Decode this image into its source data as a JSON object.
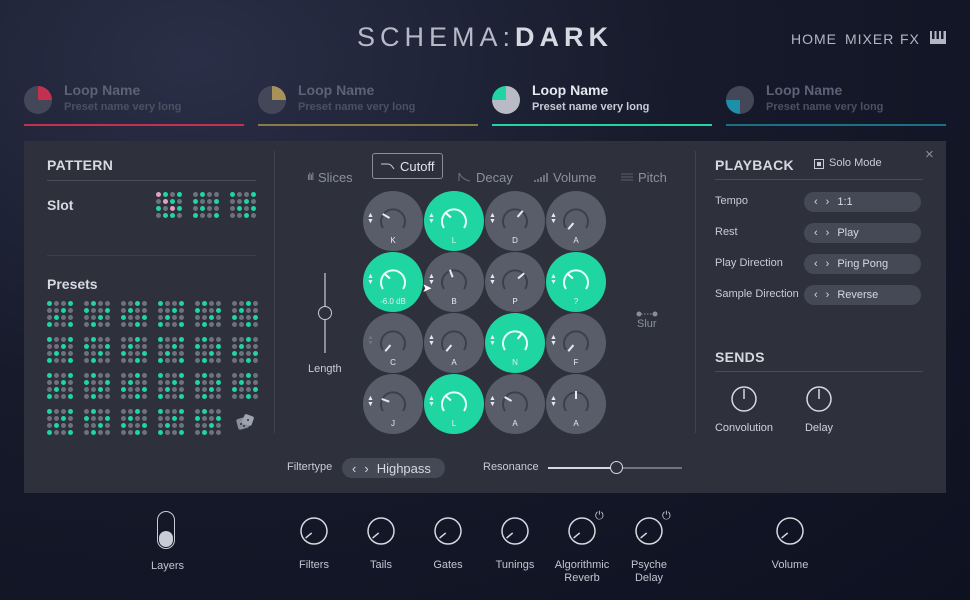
{
  "header": {
    "logo_light": "SCHEMA:",
    "logo_bold": "DARK",
    "nav": [
      "HOME",
      "MIXER",
      "FX"
    ],
    "keys_icon": "piano-keys-icon"
  },
  "layers": [
    {
      "name": "Loop Name",
      "preset": "Preset name very long",
      "color": "#c2324f"
    },
    {
      "name": "Loop Name",
      "preset": "Preset name very long",
      "color": "#a9925a"
    },
    {
      "name": "Loop Name",
      "preset": "Preset name very long",
      "color": "#1fd6a2"
    },
    {
      "name": "Loop Name",
      "preset": "Preset name very long",
      "color": "#1e8fa8"
    }
  ],
  "pattern": {
    "title": "PATTERN",
    "slot_label": "Slot",
    "presets_label": "Presets"
  },
  "tabs": [
    "Slices",
    "Cutoff",
    "Decay",
    "Volume",
    "Pitch"
  ],
  "selected_tab": "Cutoff",
  "pads": [
    {
      "letter": "K",
      "on": false
    },
    {
      "letter": "L",
      "on": true
    },
    {
      "letter": "D",
      "on": false
    },
    {
      "letter": "A",
      "on": false
    },
    {
      "letter": "-6.0 dB",
      "on": true
    },
    {
      "letter": "B",
      "on": false
    },
    {
      "letter": "P",
      "on": false
    },
    {
      "letter": "?",
      "on": true
    },
    {
      "letter": "C",
      "on": false
    },
    {
      "letter": "A",
      "on": false
    },
    {
      "letter": "N",
      "on": true
    },
    {
      "letter": "F",
      "on": false
    },
    {
      "letter": "J",
      "on": false
    },
    {
      "letter": "L",
      "on": true
    },
    {
      "letter": "A",
      "on": false
    },
    {
      "letter": "A",
      "on": false
    }
  ],
  "length_label": "Length",
  "slur_label": "Slur",
  "filtertype": {
    "label": "Filtertype",
    "value": "Highpass"
  },
  "resonance": {
    "label": "Resonance",
    "value": 0.6
  },
  "playback": {
    "title": "PLAYBACK",
    "solo_label": "Solo Mode",
    "rows": [
      {
        "label": "Tempo",
        "value": "1:1"
      },
      {
        "label": "Rest",
        "value": "Play"
      },
      {
        "label": "Play Direction",
        "value": "Ping Pong"
      },
      {
        "label": "Sample Direction",
        "value": "Reverse"
      }
    ]
  },
  "sends": {
    "title": "SENDS",
    "knobs": [
      "Convolution",
      "Delay"
    ]
  },
  "bottom": {
    "layers": "Layers",
    "knobs": [
      {
        "label": "Filters"
      },
      {
        "label": "Tails"
      },
      {
        "label": "Gates"
      },
      {
        "label": "Tunings"
      },
      {
        "label": "Algorithmic Reverb",
        "l1": "Algorithmic",
        "l2": "Reverb",
        "power": true
      },
      {
        "label": "Psyche Delay",
        "l1": "Psyche",
        "l2": "Delay",
        "power": true
      },
      {
        "label": "Volume"
      }
    ]
  },
  "colors": {
    "accent": "#1fd6a2",
    "panel": "#2e313c",
    "pad_off": "#595d6a"
  }
}
